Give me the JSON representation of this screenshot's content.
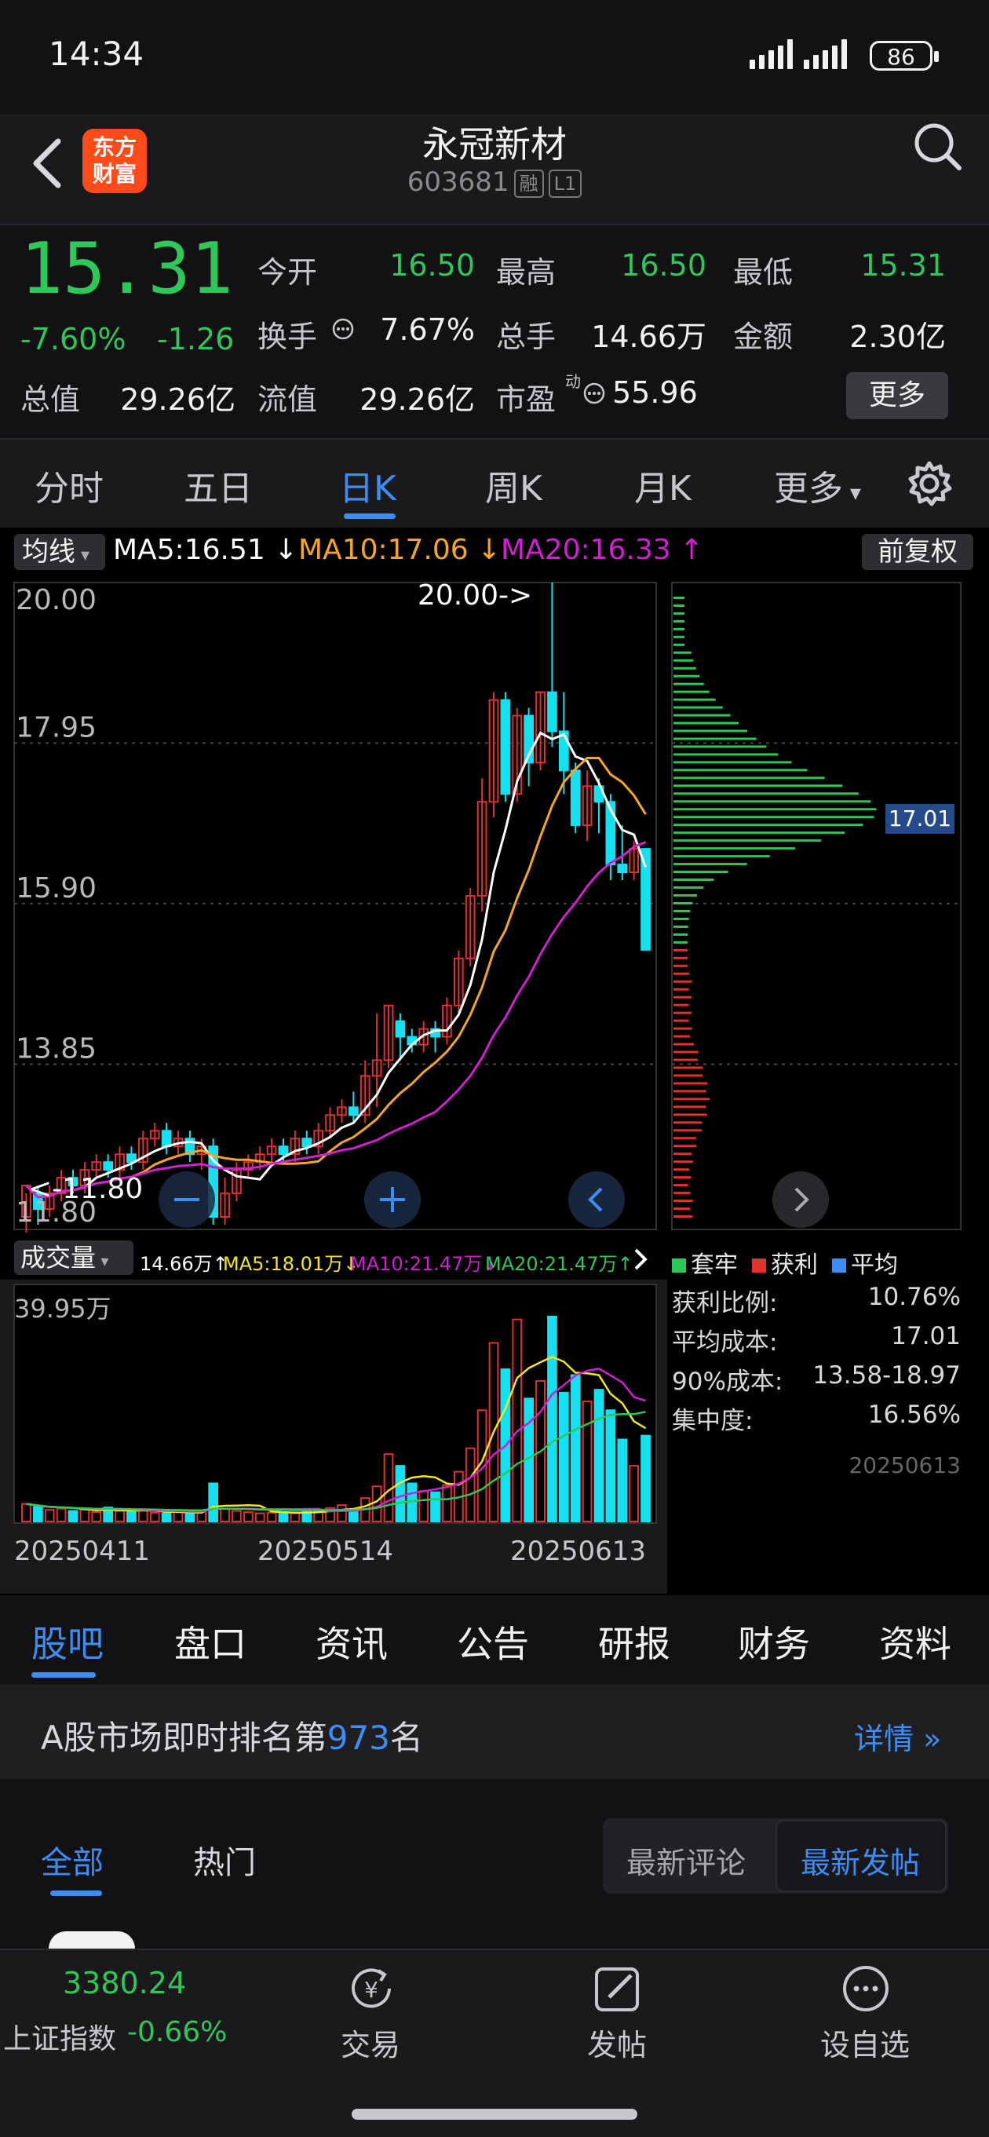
{
  "status": {
    "time": "14:34",
    "battery": "86"
  },
  "header": {
    "logo_line1": "东方",
    "logo_line2": "财富",
    "title": "永冠新材",
    "code": "603681",
    "tag1": "融",
    "tag2": "L1"
  },
  "quote": {
    "price": "15.31",
    "change_pct": "-7.60%",
    "change": "-1.26",
    "open_label": "今开",
    "open": "16.50",
    "high_label": "最高",
    "high": "16.50",
    "low_label": "最低",
    "low": "15.31",
    "turnover_label": "换手",
    "turnover": "7.67%",
    "volume_label": "总手",
    "volume": "14.66万",
    "amount_label": "金额",
    "amount": "2.30亿",
    "mcap_label": "总值",
    "mcap": "29.26亿",
    "float_label": "流值",
    "float": "29.26亿",
    "pe_label": "市盈",
    "pe_sup": "动",
    "pe": "55.96",
    "more": "更多"
  },
  "tabs": [
    {
      "label": "分时"
    },
    {
      "label": "五日"
    },
    {
      "label": "日K"
    },
    {
      "label": "周K"
    },
    {
      "label": "月K"
    },
    {
      "label": "更多"
    }
  ],
  "ma_legend": {
    "btn": "均线",
    "ma5": "MA5:16.51",
    "ma10": "MA10:17.06",
    "ma20": "MA20:16.33",
    "adj": "前复权"
  },
  "price_axis": [
    "20.00",
    "17.95",
    "15.90",
    "13.85",
    "11.80"
  ],
  "annotations": {
    "max": "20.00->",
    "min": "<-11.80",
    "cost_tag": "17.01"
  },
  "vol_legend": {
    "btn": "成交量",
    "vol": "14.66万",
    "ma5": "MA5:18.01万",
    "ma10": "MA10:21.47万",
    "ma20": "MA20:21.47万"
  },
  "vol_axis_max": "39.95万",
  "dates": [
    "20250411",
    "20250514",
    "20250613"
  ],
  "chip_legend": [
    {
      "label": "套牢",
      "color": "#2ec75a"
    },
    {
      "label": "获利",
      "color": "#e03030"
    },
    {
      "label": "平均",
      "color": "#3d8df5"
    }
  ],
  "chip_stats": [
    {
      "label": "获利比例:",
      "value": "10.76%"
    },
    {
      "label": "平均成本:",
      "value": "17.01"
    },
    {
      "label": "90%成本:",
      "value": "13.58-18.97"
    },
    {
      "label": "集中度:",
      "value": "16.56%"
    }
  ],
  "chip_date": "20250613",
  "bottom_tabs": [
    {
      "label": "股吧"
    },
    {
      "label": "盘口"
    },
    {
      "label": "资讯"
    },
    {
      "label": "公告"
    },
    {
      "label": "研报"
    },
    {
      "label": "财务"
    },
    {
      "label": "资料"
    }
  ],
  "rank": {
    "prefix": "A股市场即时排名第",
    "num": "973",
    "suffix": "名",
    "detail": "详情"
  },
  "filter": {
    "all": "全部",
    "hot": "热门",
    "latest_comment": "最新评论",
    "latest_post": "最新发帖"
  },
  "bottom_nav": {
    "index_value": "3380.24",
    "index_name": "上证指数",
    "index_change": "-0.66%",
    "trade": "交易",
    "post": "发帖",
    "watch": "设自选"
  },
  "colors": {
    "up": "#e03030",
    "down": "#2ec75a",
    "cyan": "#14e0f0",
    "ma5": "#ffffff",
    "ma10": "#f5a623",
    "ma20": "#d020d0",
    "accent": "#3d8df5"
  },
  "chart_data": {
    "type": "candlestick",
    "price_range": [
      11.8,
      20.0
    ],
    "candles": [
      [
        11.9,
        12.3,
        11.7,
        12.2
      ],
      [
        12.2,
        12.0,
        11.8,
        12.3
      ],
      [
        12.0,
        12.2,
        11.9,
        12.3
      ],
      [
        12.2,
        12.4,
        12.1,
        12.5
      ],
      [
        12.4,
        12.3,
        12.2,
        12.5
      ],
      [
        12.3,
        12.5,
        12.2,
        12.6
      ],
      [
        12.5,
        12.6,
        12.4,
        12.7
      ],
      [
        12.6,
        12.5,
        12.4,
        12.7
      ],
      [
        12.5,
        12.7,
        12.4,
        12.8
      ],
      [
        12.7,
        12.6,
        12.5,
        12.8
      ],
      [
        12.6,
        12.9,
        12.5,
        13.0
      ],
      [
        12.9,
        13.0,
        12.8,
        13.1
      ],
      [
        13.0,
        12.8,
        12.7,
        13.1
      ],
      [
        12.8,
        12.9,
        12.7,
        13.0
      ],
      [
        12.9,
        12.7,
        12.6,
        13.0
      ],
      [
        12.7,
        12.8,
        12.5,
        12.9
      ],
      [
        12.8,
        11.9,
        11.8,
        12.9
      ],
      [
        11.9,
        12.2,
        11.8,
        12.4
      ],
      [
        12.2,
        12.5,
        12.1,
        12.6
      ],
      [
        12.5,
        12.6,
        12.4,
        12.7
      ],
      [
        12.6,
        12.7,
        12.5,
        12.8
      ],
      [
        12.7,
        12.8,
        12.6,
        12.9
      ],
      [
        12.8,
        12.7,
        12.6,
        12.9
      ],
      [
        12.7,
        12.9,
        12.6,
        13.0
      ],
      [
        12.9,
        12.8,
        12.7,
        13.0
      ],
      [
        12.8,
        13.0,
        12.7,
        13.1
      ],
      [
        13.0,
        13.2,
        12.9,
        13.3
      ],
      [
        13.2,
        13.3,
        13.1,
        13.4
      ],
      [
        13.3,
        13.2,
        13.1,
        13.5
      ],
      [
        13.2,
        13.7,
        13.1,
        13.9
      ],
      [
        13.7,
        13.9,
        13.3,
        14.5
      ],
      [
        13.9,
        14.6,
        13.8,
        14.6
      ],
      [
        14.4,
        14.2,
        13.9,
        14.5
      ],
      [
        14.2,
        14.1,
        14.0,
        14.3
      ],
      [
        14.1,
        14.3,
        14.0,
        14.4
      ],
      [
        14.3,
        14.2,
        14.0,
        14.4
      ],
      [
        14.2,
        14.6,
        14.1,
        14.7
      ],
      [
        14.6,
        15.2,
        14.5,
        15.3
      ],
      [
        15.2,
        16.0,
        15.1,
        16.1
      ],
      [
        16.0,
        17.2,
        15.8,
        17.5
      ],
      [
        17.2,
        18.5,
        17.0,
        18.6
      ],
      [
        18.5,
        17.3,
        17.2,
        18.6
      ],
      [
        17.3,
        18.3,
        17.2,
        18.4
      ],
      [
        18.3,
        17.7,
        17.4,
        18.4
      ],
      [
        17.7,
        18.6,
        17.6,
        18.6
      ],
      [
        18.6,
        18.1,
        17.9,
        20.0
      ],
      [
        18.1,
        17.6,
        17.3,
        18.6
      ],
      [
        17.6,
        16.9,
        16.8,
        17.7
      ],
      [
        16.9,
        17.4,
        16.7,
        17.6
      ],
      [
        17.4,
        17.2,
        16.8,
        17.5
      ],
      [
        17.2,
        16.4,
        16.2,
        17.3
      ],
      [
        16.4,
        16.3,
        16.2,
        16.9
      ],
      [
        16.3,
        16.6,
        16.2,
        16.7
      ],
      [
        16.6,
        15.31,
        15.31,
        16.5
      ]
    ],
    "ma5_label": "MA5:16.51",
    "ma10_label": "MA10:17.06",
    "ma20_label": "MA20:16.33",
    "volume_range": [
      0,
      39.95
    ],
    "volumes": [
      3.0,
      2.5,
      2.0,
      2.2,
      1.8,
      2.0,
      1.6,
      2.4,
      1.8,
      1.6,
      2.0,
      1.5,
      1.4,
      1.6,
      1.3,
      1.8,
      6.5,
      2.2,
      1.8,
      1.6,
      1.4,
      1.5,
      1.6,
      1.4,
      1.7,
      1.8,
      2.3,
      2.8,
      2.1,
      4.0,
      6.0,
      11.5,
      9.5,
      6.5,
      5.2,
      5.0,
      6.2,
      8.5,
      12.5,
      19.0,
      30.5,
      26.0,
      34.5,
      21.0,
      24.0,
      35.0,
      22.0,
      25.0,
      20.5,
      22.5,
      19.0,
      14.0,
      9.5,
      14.66
    ],
    "chip_peak": 17.01
  }
}
